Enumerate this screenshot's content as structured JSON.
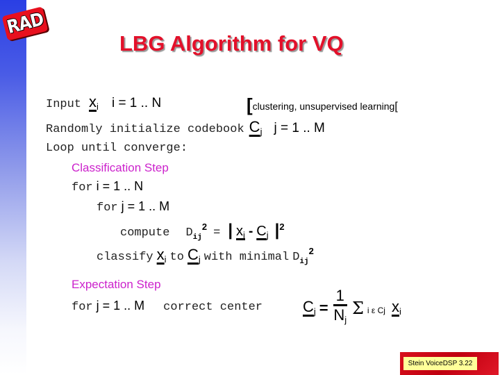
{
  "logo": {
    "text": "RAD"
  },
  "title": "LBG Algorithm for VQ",
  "lines": {
    "input": {
      "label": "Input",
      "var": "x",
      "sub": "i",
      "range": "i = 1 .. N",
      "note_open": "[",
      "note": "clustering, unsupervised learning",
      "note_close": "["
    },
    "init": {
      "label": "Randomly initialize codebook",
      "var": "C",
      "sub": "j",
      "range": "j = 1 .. M"
    },
    "loop": {
      "label": "Loop until converge:"
    },
    "classification": {
      "heading": "Classification Step",
      "for_i": {
        "kw": "for",
        "range": "i = 1 .. N"
      },
      "for_j": {
        "kw": "for",
        "range": "j = 1 .. M"
      },
      "compute": {
        "kw": "compute",
        "D": "D",
        "Dsub": "ij",
        "Dsup": "2",
        "eq": "=",
        "x": "x",
        "xsub": "i",
        "minus": "-",
        "c": "C",
        "csub": "j",
        "sup": "2"
      },
      "classify": {
        "kw": "classify",
        "x": "x",
        "xsub": "i",
        "to": "to",
        "c": "C",
        "csub": "j",
        "rest": "with minimal",
        "D": "D",
        "Dsub": "ij",
        "Dsup": "2"
      }
    },
    "expectation": {
      "heading": "Expectation Step",
      "for_j": {
        "kw": "for",
        "range": "j = 1 .. M"
      },
      "correct": {
        "label": "correct center",
        "c": "C",
        "csub": "j",
        "eq": "=",
        "num": "1",
        "den": "N",
        "densub": "j",
        "sigma": "Σ",
        "sumsub": "i ε Cj",
        "x": "x",
        "xsub": "i"
      }
    }
  },
  "footer": {
    "label": "Stein VoiceDSP 3.22"
  },
  "colors": {
    "title": "#e3102a",
    "step_heading": "#cc22cc",
    "footer_bg": "#d8101c",
    "footer_label_bg": "#ffff99",
    "sidebar_top": "#2a3fe4"
  }
}
